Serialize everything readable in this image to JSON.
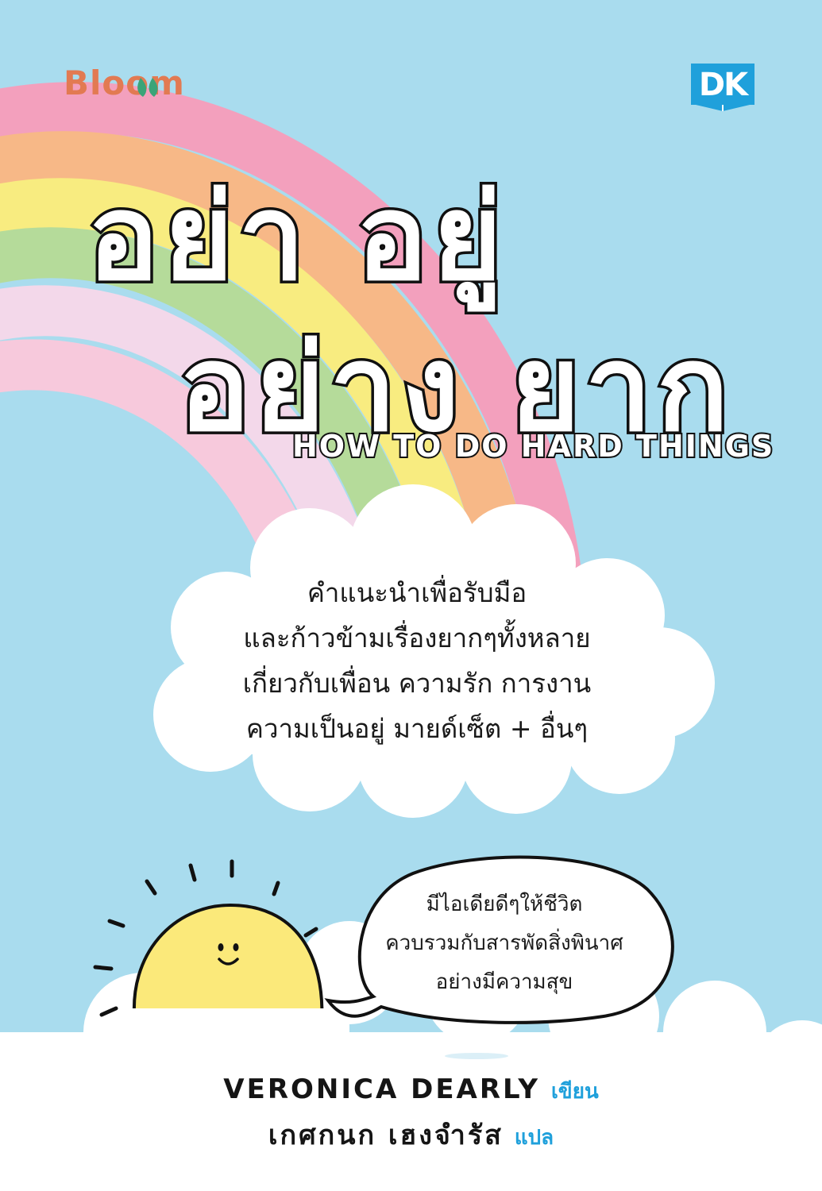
{
  "publishers": {
    "left": "Bloom",
    "right": "DK"
  },
  "title": {
    "line1": "อย่า อยู่",
    "line2": "อย่าง ยาก",
    "english": "HOW TO DO HARD THINGS"
  },
  "tagline": [
    "คำแนะนำเพื่อรับมือ",
    "และก้าวข้ามเรื่องยากๆทั้งหลาย",
    "เกี่ยวกับเพื่อน ความรัก การงาน",
    "ความเป็นอยู่ มายด์เซ็ต + อื่นๆ"
  ],
  "speech_bubble": [
    "มีไอเดียดีๆให้ชีวิต",
    "ควบรวมกับสารพัดสิ่งพินาศ",
    "อย่างมีความสุข"
  ],
  "credits": {
    "author": {
      "name": "VERONICA DEARLY",
      "role": "เขียน"
    },
    "translator": {
      "name": "เกศกนก เฮงจำรัส",
      "role": "แปล"
    }
  },
  "colors": {
    "sky": "#a9dcee",
    "bloom_brand": "#e27a52",
    "dk_brand": "#1fa0db",
    "rainbow": [
      "#f3a0bd",
      "#f7b887",
      "#f8ec80",
      "#b5db9a",
      "#f3d8ea",
      "#f7c9dc"
    ],
    "sun": "#fbe97a"
  },
  "icons": [
    "bloom-leaf-icon",
    "dk-book-icon",
    "sun-character-icon",
    "cloud-icon",
    "speech-bubble-icon"
  ]
}
